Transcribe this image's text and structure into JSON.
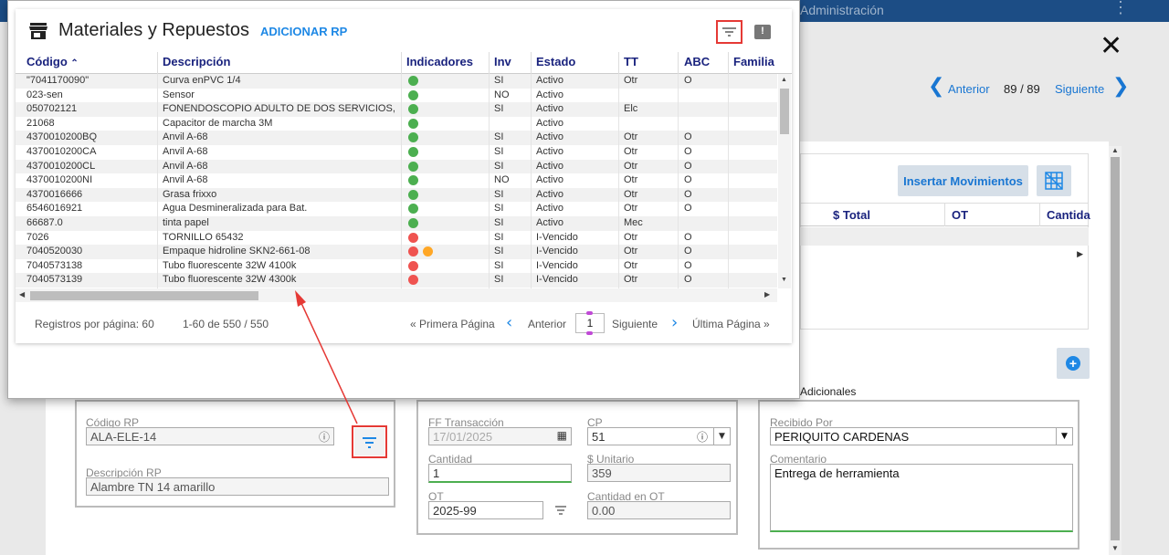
{
  "topbar": {
    "title": "Administración"
  },
  "nav": {
    "prev": "Anterior",
    "position": "89 / 89",
    "next": "Siguiente"
  },
  "bg": {
    "insert_button": "Insertar Movimientos",
    "columns": [
      "$ Total",
      "OT",
      "Cantida"
    ],
    "additional_label": "Adicionales"
  },
  "form": {
    "codigo_label": "Código RP",
    "codigo_value": "ALA-ELE-14",
    "descripcion_label": "Descripción RP",
    "descripcion_value": "Alambre TN 14 amarillo",
    "ff_label": "FF Transacción",
    "ff_value": "17/01/2025",
    "cp_label": "CP",
    "cp_value": "51",
    "cantidad_label": "Cantidad",
    "cantidad_value": "1",
    "unitario_label": "$ Unitario",
    "unitario_value": "359",
    "ot_label": "OT",
    "ot_value": "2025-99",
    "cant_ot_label": "Cantidad en OT",
    "cant_ot_value": "0.00",
    "recibido_label": "Recibido Por",
    "recibido_value": "PERIQUITO CARDENAS",
    "comentario_label": "Comentario",
    "comentario_value": "Entrega de herramienta"
  },
  "modal": {
    "title": "Materiales y Repuestos",
    "add_link": "ADICIONAR RP",
    "columns": [
      "Código",
      "Descripción",
      "Indicadores",
      "Inv",
      "Estado",
      "TT",
      "ABC",
      "Familia"
    ],
    "rows": [
      {
        "codigo": "\"7041170090\"",
        "desc": "Curva enPVC 1/4",
        "ind": [
          "green"
        ],
        "inv": "SI",
        "estado": "Activo",
        "tt": "Otr",
        "abc": "O"
      },
      {
        "codigo": "023-sen",
        "desc": "Sensor",
        "ind": [
          "green"
        ],
        "inv": "NO",
        "estado": "Activo",
        "tt": "",
        "abc": ""
      },
      {
        "codigo": "050702121",
        "desc": "FONENDOSCOPIO ADULTO DE DOS SERVICIOS, M...",
        "ind": [
          "green"
        ],
        "inv": "SI",
        "estado": "Activo",
        "tt": "Elc",
        "abc": ""
      },
      {
        "codigo": "21068",
        "desc": "Capacitor de marcha 3M",
        "ind": [
          "green"
        ],
        "inv": "",
        "estado": "Activo",
        "tt": "",
        "abc": ""
      },
      {
        "codigo": "4370010200BQ",
        "desc": "Anvil A-68",
        "ind": [
          "green"
        ],
        "inv": "SI",
        "estado": "Activo",
        "tt": "Otr",
        "abc": "O"
      },
      {
        "codigo": "4370010200CA",
        "desc": "Anvil A-68",
        "ind": [
          "green"
        ],
        "inv": "SI",
        "estado": "Activo",
        "tt": "Otr",
        "abc": "O"
      },
      {
        "codigo": "4370010200CL",
        "desc": "Anvil A-68",
        "ind": [
          "green"
        ],
        "inv": "SI",
        "estado": "Activo",
        "tt": "Otr",
        "abc": "O"
      },
      {
        "codigo": "4370010200NI",
        "desc": "Anvil A-68",
        "ind": [
          "green"
        ],
        "inv": "NO",
        "estado": "Activo",
        "tt": "Otr",
        "abc": "O"
      },
      {
        "codigo": "4370016666",
        "desc": "Grasa frixxo",
        "ind": [
          "green"
        ],
        "inv": "SI",
        "estado": "Activo",
        "tt": "Otr",
        "abc": "O"
      },
      {
        "codigo": "6546016921",
        "desc": "Agua Desmineralizada para Bat.",
        "ind": [
          "green"
        ],
        "inv": "SI",
        "estado": "Activo",
        "tt": "Otr",
        "abc": "O"
      },
      {
        "codigo": "66687.0",
        "desc": "tinta papel",
        "ind": [
          "green"
        ],
        "inv": "SI",
        "estado": "Activo",
        "tt": "Mec",
        "abc": ""
      },
      {
        "codigo": "7026",
        "desc": "TORNILLO 65432",
        "ind": [
          "red"
        ],
        "inv": "SI",
        "estado": "I-Vencido",
        "tt": "Otr",
        "abc": "O"
      },
      {
        "codigo": "7040520030",
        "desc": "Empaque hidroline SKN2-661-08",
        "ind": [
          "red",
          "orange"
        ],
        "inv": "SI",
        "estado": "I-Vencido",
        "tt": "Otr",
        "abc": "O"
      },
      {
        "codigo": "7040573138",
        "desc": "Tubo fluorescente 32W 4100k",
        "ind": [
          "red"
        ],
        "inv": "SI",
        "estado": "I-Vencido",
        "tt": "Otr",
        "abc": "O"
      },
      {
        "codigo": "7040573139",
        "desc": "Tubo fluorescente 32W 4300k",
        "ind": [
          "red"
        ],
        "inv": "SI",
        "estado": "I-Vencido",
        "tt": "Otr",
        "abc": "O"
      }
    ],
    "footer": {
      "per_page_label": "Registros por página: 60",
      "range": "1-60 de 550 / 550",
      "first": "« Primera Página",
      "prev": "Anterior",
      "page": "1",
      "next": "Siguiente",
      "last": "Última Página »"
    }
  },
  "colors": {
    "green": "#4caf50",
    "red": "#ef5350",
    "orange": "#ffa726",
    "accent": "#1e88e5",
    "header_text": "#1a237e",
    "annotation": "#e53935"
  }
}
